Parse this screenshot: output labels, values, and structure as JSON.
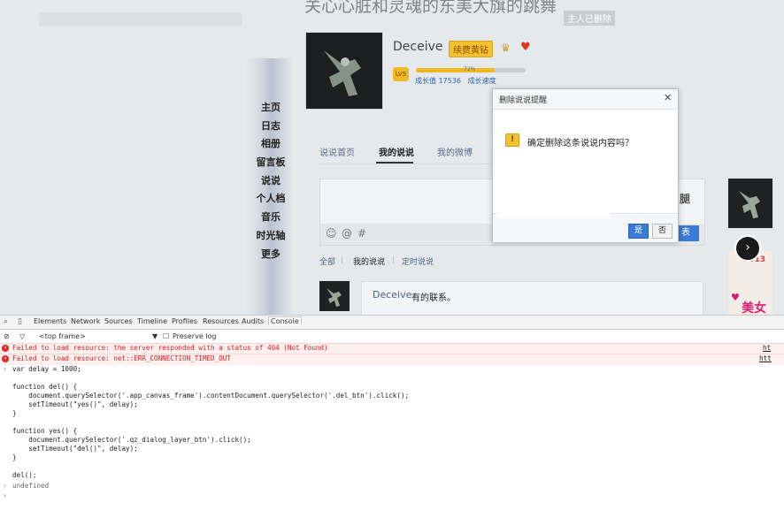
{
  "page": {
    "banner_title": "关心心脏和灵魂的东美大旗的跳舞",
    "already_deleted": "主人已删除",
    "nav": [
      "主页",
      "日志",
      "相册",
      "留言板",
      "说说",
      "个人档",
      "音乐",
      "时光轴",
      "更多"
    ],
    "profile": {
      "name": "Deceive",
      "vip_label": "续费黄钻",
      "level_badge": "LV5",
      "growth_percent": 72,
      "growth_pct_label": "72%",
      "growth_value_label": "成长值 17536",
      "growth_speed_label": "成长速度"
    },
    "tabs": [
      "说说首页",
      "我的说说",
      "我的微博"
    ],
    "active_tab": 1,
    "tools": {
      "emoji": "☺",
      "at": "@",
      "topic": "#"
    },
    "publish_label": "表",
    "side_logo": "腿",
    "filters": [
      "全部",
      "我的说说",
      "定时说说"
    ],
    "feed": {
      "name": "Deceive",
      "text": "有的联系。"
    },
    "ad": {
      "year": "2013",
      "text": "美女"
    }
  },
  "dialog": {
    "title": "删除说说提醒",
    "message": "确定删除这条说说内容吗？",
    "yes_label": "是",
    "no_label": "否"
  },
  "devtools": {
    "tabs": [
      "Elements",
      "Network",
      "Sources",
      "Timeline",
      "Profiles",
      "Resources",
      "Audits",
      "Console"
    ],
    "active_tab": "Console",
    "frame_label": "<top frame>",
    "preserve_log_label": "Preserve log",
    "errors": [
      {
        "text": "Failed to load resource: the server responded with a status of 404 (Not Found)",
        "link": "ht"
      },
      {
        "text": "Failed to load resource: net::ERR_CONNECTION_TIMED_OUT",
        "link": "htt"
      }
    ],
    "code_lines": [
      "var delay = 1000;",
      "",
      "function del() {",
      "    document.querySelector('.app_canvas_frame').contentDocument.querySelector('.del_btn').click();",
      "    setTimeout(\"yes()\", delay);",
      "}",
      "",
      "function yes() {",
      "    document.querySelector('.qz_dialog_layer_btn').click();",
      "    setTimeout(\"del()\", delay);",
      "}",
      "",
      "del();"
    ],
    "result": "undefined"
  },
  "colors": {
    "accent": "#3b7bd5",
    "error": "#d81f1f",
    "vip": "#f5c12e"
  }
}
